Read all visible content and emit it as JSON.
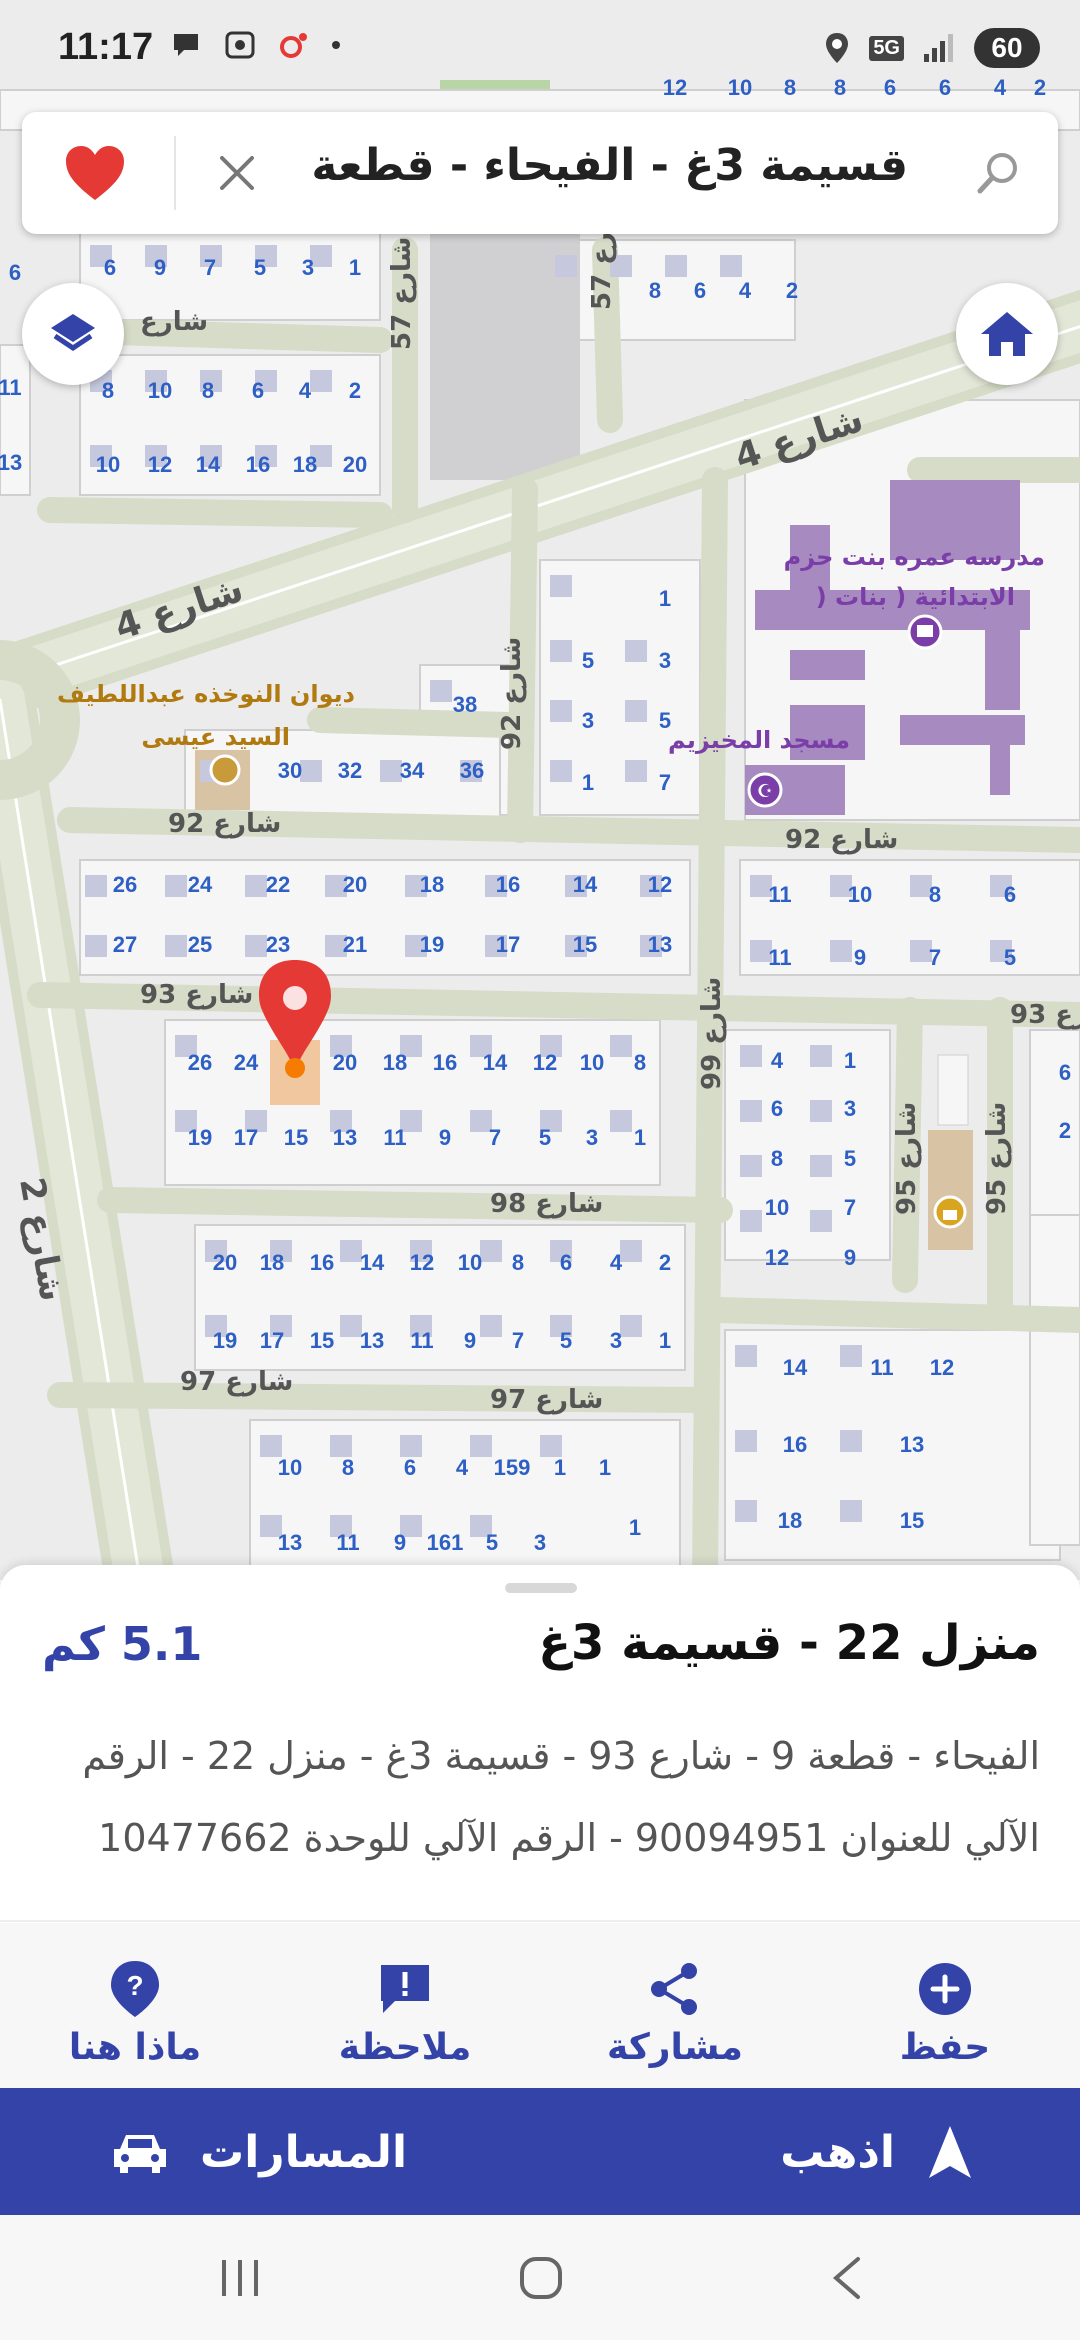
{
  "status_bar": {
    "time": "11:17",
    "network": "5G",
    "battery": "60"
  },
  "search": {
    "query": "قسيمة 3غ - الفيحاء - قطعة"
  },
  "map": {
    "labels": {
      "school": "مدرسه عمره بنت حزم",
      "school_line2": ") الابتدائية ( بنات",
      "mosque": "مسجد المخيزيم",
      "diwan": "ديوان النوخذه عبداللطيف",
      "diwan_line2": "السيد عيسى"
    },
    "streets": {
      "s4": "شارع 4",
      "s2": "شارع 2",
      "s57": "شارع 57",
      "s92": "شارع 92",
      "s93": "شارع 93",
      "s98": "شارع 98",
      "s97": "شارع 97",
      "s99": "شارع 99",
      "s95": "شارع 95",
      "street": "شارع"
    }
  },
  "place": {
    "title": "منزل 22 - قسيمة 3غ",
    "distance": "5.1 كم",
    "address": "الفيحاء - قطعة 9 - شارع 93 - قسيمة 3غ - منزل 22 - الرقم الآلي للعنوان 90094951 - الرقم الآلي للوحدة 10477662"
  },
  "actions": {
    "save": "حفظ",
    "share": "مشاركة",
    "note": "ملاحظة",
    "whats_here": "ماذا هنا"
  },
  "nav": {
    "go": "اذهب",
    "routes": "المسارات"
  },
  "colors": {
    "accent": "#3343a8",
    "marker": "#e53935",
    "road": "#d6dcc8",
    "building": "#c6c9de",
    "poi_purple": "#a68ac0"
  }
}
